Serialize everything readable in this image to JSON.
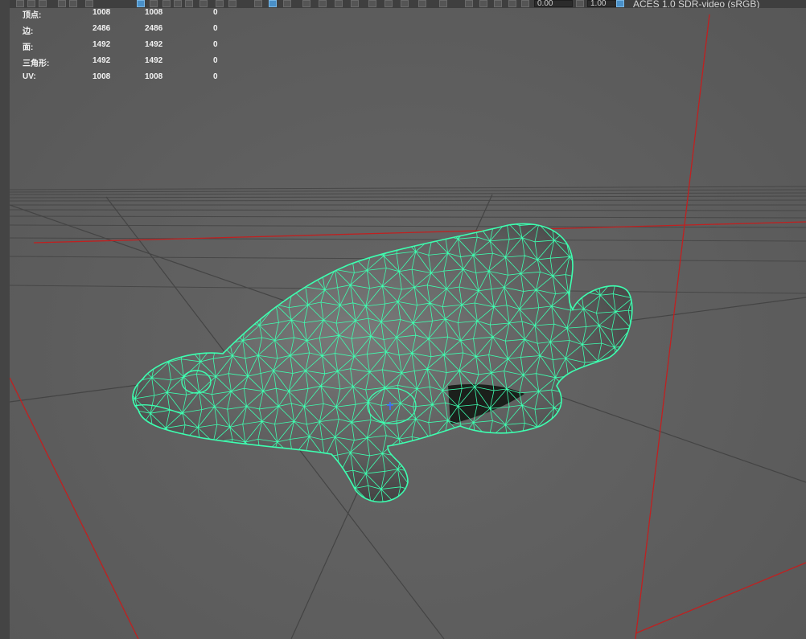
{
  "toolbar": {
    "exposure_value": "0.00",
    "gamma_value": "1.00",
    "color_space": "ACES 1.0 SDR-video (sRGB)",
    "icons": [
      "select-icon",
      "lasso-icon",
      "paint-icon",
      "move-icon",
      "rotate-icon",
      "scale-icon",
      "grid-icon",
      "wireframe-icon",
      "shaded-icon",
      "textured-icon",
      "light-icon",
      "shadow-icon",
      "isolate-icon",
      "xray-icon",
      "camera-icon",
      "film-gate-icon",
      "resolution-gate-icon",
      "exposure-icon",
      "gamma-icon",
      "color-management-icon"
    ]
  },
  "hud": {
    "rows": [
      {
        "label": "顶点:",
        "v1": "1008",
        "v2": "1008",
        "v3": "0"
      },
      {
        "label": "边:",
        "v1": "2486",
        "v2": "2486",
        "v3": "0"
      },
      {
        "label": "面:",
        "v1": "1492",
        "v2": "1492",
        "v3": "0"
      },
      {
        "label": "三角形:",
        "v1": "1492",
        "v2": "1492",
        "v3": "0"
      },
      {
        "label": "UV:",
        "v1": "1008",
        "v2": "1008",
        "v3": "0"
      }
    ]
  },
  "viewport": {
    "wireframe_color": "#3dffb0",
    "grid_color": "#474747",
    "axis_color": "#c02020"
  }
}
